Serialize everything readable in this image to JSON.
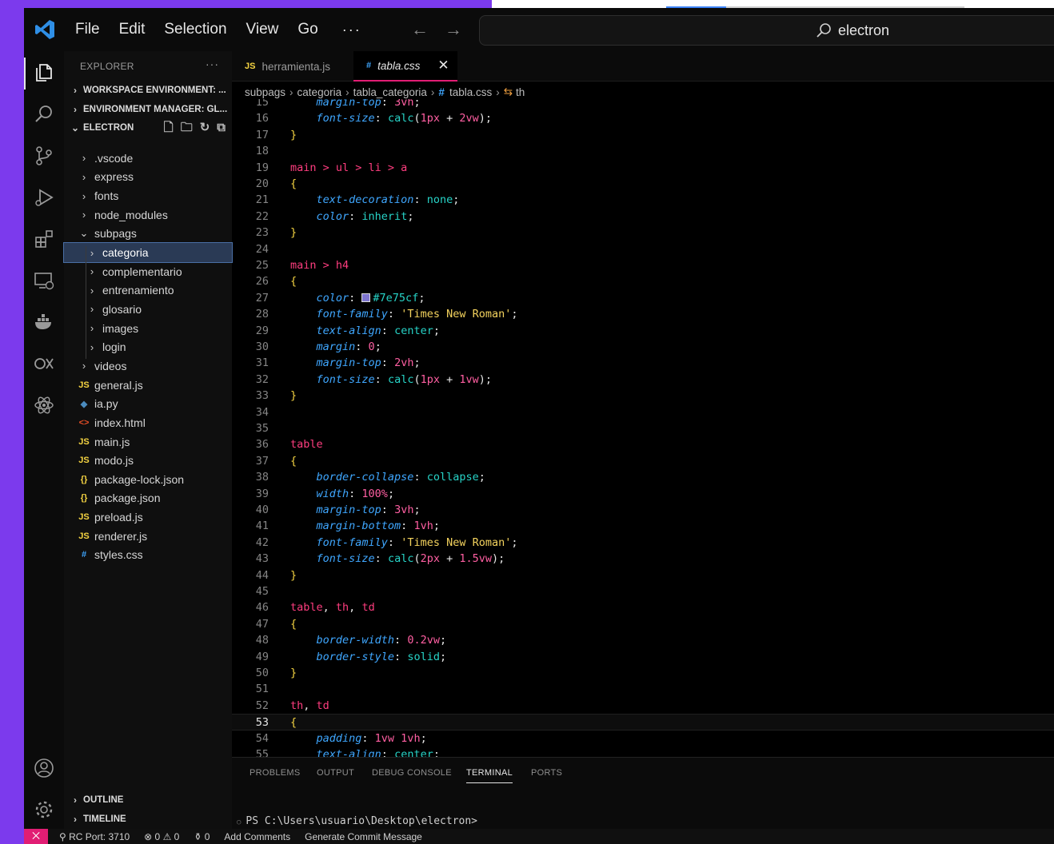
{
  "menu": [
    "File",
    "Edit",
    "Selection",
    "View",
    "Go"
  ],
  "menu_more": "···",
  "search": {
    "text": "electron"
  },
  "explorer": {
    "title": "EXPLORER",
    "more": "···",
    "sections": {
      "workspace": "WORKSPACE ENVIRONMENT: ...",
      "envmanager": "ENVIRONMENT MANAGER: GL...",
      "electron": "ELECTRON"
    },
    "tree": [
      {
        "label": ".vscode",
        "kind": "folder",
        "depth": 0
      },
      {
        "label": "express",
        "kind": "folder",
        "depth": 0
      },
      {
        "label": "fonts",
        "kind": "folder",
        "depth": 0
      },
      {
        "label": "node_modules",
        "kind": "folder",
        "depth": 0
      },
      {
        "label": "subpags",
        "kind": "folder-open",
        "depth": 0
      },
      {
        "label": "categoria",
        "kind": "folder",
        "depth": 1,
        "selected": true
      },
      {
        "label": "complementario",
        "kind": "folder",
        "depth": 1
      },
      {
        "label": "entrenamiento",
        "kind": "folder",
        "depth": 1
      },
      {
        "label": "glosario",
        "kind": "folder",
        "depth": 1
      },
      {
        "label": "images",
        "kind": "folder",
        "depth": 1
      },
      {
        "label": "login",
        "kind": "folder",
        "depth": 1
      },
      {
        "label": "videos",
        "kind": "folder",
        "depth": 0
      },
      {
        "label": "general.js",
        "kind": "js",
        "depth": 0
      },
      {
        "label": "ia.py",
        "kind": "py",
        "depth": 0
      },
      {
        "label": "index.html",
        "kind": "html",
        "depth": 0
      },
      {
        "label": "main.js",
        "kind": "js",
        "depth": 0
      },
      {
        "label": "modo.js",
        "kind": "js",
        "depth": 0
      },
      {
        "label": "package-lock.json",
        "kind": "json",
        "depth": 0
      },
      {
        "label": "package.json",
        "kind": "json",
        "depth": 0
      },
      {
        "label": "preload.js",
        "kind": "js",
        "depth": 0
      },
      {
        "label": "renderer.js",
        "kind": "js",
        "depth": 0
      },
      {
        "label": "styles.css",
        "kind": "css",
        "depth": 0
      }
    ],
    "outline": "OUTLINE",
    "timeline": "TIMELINE"
  },
  "file_icons": {
    "js": {
      "glyph": "JS",
      "color": "#f5d442"
    },
    "py": {
      "glyph": "◆",
      "color": "#4b8bbe"
    },
    "html": {
      "glyph": "<>",
      "color": "#e44d26"
    },
    "json": {
      "glyph": "{}",
      "color": "#f5d442"
    },
    "css": {
      "glyph": "#",
      "color": "#3fa7ff"
    }
  },
  "tabs": [
    {
      "icon": "JS",
      "label": "herramienta.js",
      "active": false
    },
    {
      "icon": "#",
      "label": "tabla.css",
      "active": true,
      "close": "✕"
    }
  ],
  "breadcrumb": [
    "subpags",
    "categoria",
    "tabla_categoria",
    "tabla.css",
    "th"
  ],
  "code": {
    "current_line": 53,
    "lines": [
      {
        "n": "15",
        "tokens": [
          [
            "prop",
            "    margin-top"
          ],
          [
            "punc",
            ": "
          ],
          [
            "num",
            "3vh"
          ],
          [
            "punc",
            ";"
          ]
        ]
      },
      {
        "n": "16",
        "tokens": [
          [
            "prop",
            "    font-size"
          ],
          [
            "punc",
            ": "
          ],
          [
            "fn",
            "calc"
          ],
          [
            "punc",
            "("
          ],
          [
            "num",
            "1px"
          ],
          [
            "punc",
            " + "
          ],
          [
            "num",
            "2vw"
          ],
          [
            "punc",
            ");"
          ]
        ]
      },
      {
        "n": "17",
        "tokens": [
          [
            "brace",
            "}"
          ]
        ]
      },
      {
        "n": "18",
        "tokens": []
      },
      {
        "n": "19",
        "tokens": [
          [
            "sel",
            "main > ul > li > a"
          ]
        ]
      },
      {
        "n": "20",
        "tokens": [
          [
            "brace",
            "{"
          ]
        ]
      },
      {
        "n": "21",
        "tokens": [
          [
            "prop",
            "    text-decoration"
          ],
          [
            "punc",
            ": "
          ],
          [
            "val",
            "none"
          ],
          [
            "punc",
            ";"
          ]
        ]
      },
      {
        "n": "22",
        "tokens": [
          [
            "prop",
            "    color"
          ],
          [
            "punc",
            ": "
          ],
          [
            "val",
            "inherit"
          ],
          [
            "punc",
            ";"
          ]
        ]
      },
      {
        "n": "23",
        "tokens": [
          [
            "brace",
            "}"
          ]
        ]
      },
      {
        "n": "24",
        "tokens": []
      },
      {
        "n": "25",
        "tokens": [
          [
            "sel",
            "main > h4"
          ]
        ]
      },
      {
        "n": "26",
        "tokens": [
          [
            "brace",
            "{"
          ]
        ]
      },
      {
        "n": "27",
        "tokens": [
          [
            "prop",
            "    color"
          ],
          [
            "punc",
            ": "
          ],
          [
            "swatch",
            ""
          ],
          [
            "val",
            "#7e75cf"
          ],
          [
            "punc",
            ";"
          ]
        ]
      },
      {
        "n": "28",
        "tokens": [
          [
            "prop",
            "    font-family"
          ],
          [
            "punc",
            ": "
          ],
          [
            "str",
            "'Times New Roman'"
          ],
          [
            "punc",
            ";"
          ]
        ]
      },
      {
        "n": "29",
        "tokens": [
          [
            "prop",
            "    text-align"
          ],
          [
            "punc",
            ": "
          ],
          [
            "val",
            "center"
          ],
          [
            "punc",
            ";"
          ]
        ]
      },
      {
        "n": "30",
        "tokens": [
          [
            "prop",
            "    margin"
          ],
          [
            "punc",
            ": "
          ],
          [
            "num",
            "0"
          ],
          [
            "punc",
            ";"
          ]
        ]
      },
      {
        "n": "31",
        "tokens": [
          [
            "prop",
            "    margin-top"
          ],
          [
            "punc",
            ": "
          ],
          [
            "num",
            "2vh"
          ],
          [
            "punc",
            ";"
          ]
        ]
      },
      {
        "n": "32",
        "tokens": [
          [
            "prop",
            "    font-size"
          ],
          [
            "punc",
            ": "
          ],
          [
            "fn",
            "calc"
          ],
          [
            "punc",
            "("
          ],
          [
            "num",
            "1px"
          ],
          [
            "punc",
            " + "
          ],
          [
            "num",
            "1vw"
          ],
          [
            "punc",
            ");"
          ]
        ]
      },
      {
        "n": "33",
        "tokens": [
          [
            "brace",
            "}"
          ]
        ]
      },
      {
        "n": "34",
        "tokens": []
      },
      {
        "n": "35",
        "tokens": []
      },
      {
        "n": "36",
        "tokens": [
          [
            "sel",
            "table"
          ]
        ]
      },
      {
        "n": "37",
        "tokens": [
          [
            "brace",
            "{"
          ]
        ]
      },
      {
        "n": "38",
        "tokens": [
          [
            "prop",
            "    border-collapse"
          ],
          [
            "punc",
            ": "
          ],
          [
            "val",
            "collapse"
          ],
          [
            "punc",
            ";"
          ]
        ]
      },
      {
        "n": "39",
        "tokens": [
          [
            "prop",
            "    width"
          ],
          [
            "punc",
            ": "
          ],
          [
            "num",
            "100%"
          ],
          [
            "punc",
            ";"
          ]
        ]
      },
      {
        "n": "40",
        "tokens": [
          [
            "prop",
            "    margin-top"
          ],
          [
            "punc",
            ": "
          ],
          [
            "num",
            "3vh"
          ],
          [
            "punc",
            ";"
          ]
        ]
      },
      {
        "n": "41",
        "tokens": [
          [
            "prop",
            "    margin-bottom"
          ],
          [
            "punc",
            ": "
          ],
          [
            "num",
            "1vh"
          ],
          [
            "punc",
            ";"
          ]
        ]
      },
      {
        "n": "42",
        "tokens": [
          [
            "prop",
            "    font-family"
          ],
          [
            "punc",
            ": "
          ],
          [
            "str",
            "'Times New Roman'"
          ],
          [
            "punc",
            ";"
          ]
        ]
      },
      {
        "n": "43",
        "tokens": [
          [
            "prop",
            "    font-size"
          ],
          [
            "punc",
            ": "
          ],
          [
            "fn",
            "calc"
          ],
          [
            "punc",
            "("
          ],
          [
            "num",
            "2px"
          ],
          [
            "punc",
            " + "
          ],
          [
            "num",
            "1.5vw"
          ],
          [
            "punc",
            ");"
          ]
        ]
      },
      {
        "n": "44",
        "tokens": [
          [
            "brace",
            "}"
          ]
        ]
      },
      {
        "n": "45",
        "tokens": []
      },
      {
        "n": "46",
        "tokens": [
          [
            "sel",
            "table"
          ],
          [
            "punc",
            ", "
          ],
          [
            "sel",
            "th"
          ],
          [
            "punc",
            ", "
          ],
          [
            "sel",
            "td"
          ]
        ]
      },
      {
        "n": "47",
        "tokens": [
          [
            "brace",
            "{"
          ]
        ]
      },
      {
        "n": "48",
        "tokens": [
          [
            "prop",
            "    border-width"
          ],
          [
            "punc",
            ": "
          ],
          [
            "num",
            "0.2vw"
          ],
          [
            "punc",
            ";"
          ]
        ]
      },
      {
        "n": "49",
        "tokens": [
          [
            "prop",
            "    border-style"
          ],
          [
            "punc",
            ": "
          ],
          [
            "val",
            "solid"
          ],
          [
            "punc",
            ";"
          ]
        ]
      },
      {
        "n": "50",
        "tokens": [
          [
            "brace",
            "}"
          ]
        ]
      },
      {
        "n": "51",
        "tokens": []
      },
      {
        "n": "52",
        "tokens": [
          [
            "sel",
            "th"
          ],
          [
            "punc",
            ", "
          ],
          [
            "sel",
            "td"
          ]
        ]
      },
      {
        "n": "53",
        "tokens": [
          [
            "brace",
            "{"
          ]
        ]
      },
      {
        "n": "54",
        "tokens": [
          [
            "prop",
            "    padding"
          ],
          [
            "punc",
            ": "
          ],
          [
            "num",
            "1vw 1vh"
          ],
          [
            "punc",
            ";"
          ]
        ]
      },
      {
        "n": "55",
        "tokens": [
          [
            "prop",
            "    text-align"
          ],
          [
            "punc",
            ": "
          ],
          [
            "val",
            "center"
          ],
          [
            "punc",
            ";"
          ]
        ]
      }
    ]
  },
  "panel": {
    "tabs": [
      "PROBLEMS",
      "OUTPUT",
      "DEBUG CONSOLE",
      "TERMINAL",
      "PORTS"
    ],
    "active": "TERMINAL",
    "terminal_line": "PS C:\\Users\\usuario\\Desktop\\electron>"
  },
  "status": {
    "remote": "⨉",
    "port": "RC Port: 3710",
    "problems": "⊗ 0 ⚠ 0",
    "ports": "0",
    "comments": "Add Comments",
    "commit": "Generate Commit Message"
  }
}
